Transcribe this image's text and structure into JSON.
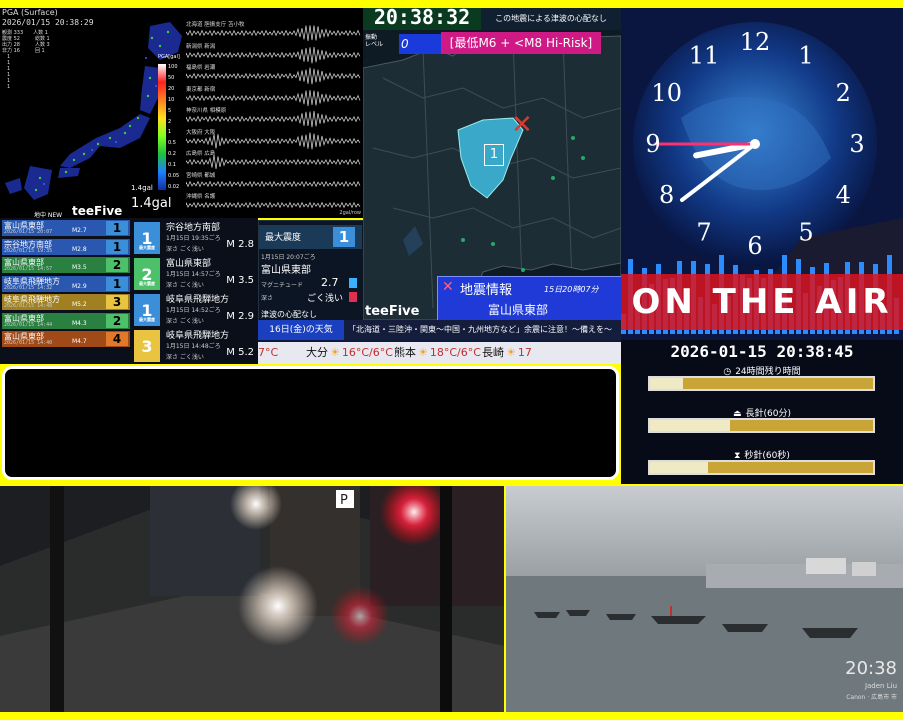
{
  "seismic": {
    "title": "PGA (Surface)",
    "timestamp": "2026/01/15 20:38:29",
    "scale_label": "PGA[gal]",
    "scale_ticks": [
      "100",
      "50",
      "20",
      "10",
      "5",
      "2",
      "1",
      "0.5",
      "0.2",
      "0.1",
      "0.05",
      "0.02"
    ],
    "gal_small": "1.4gal",
    "gal_big": "1.4gal",
    "new_label": "地中 NEW",
    "brand": "teeFive",
    "traces": [
      "北海道 胆振支庁 苫小牧",
      "新潟県 新潟",
      "福島県 岩瀬",
      "東京都 新宿",
      "神奈川県 相模原",
      "大阪府 大阪",
      "広島県 広島",
      "宮崎県 都城",
      "沖縄県 名護"
    ],
    "bottom_right": "2gal/row"
  },
  "history": [
    {
      "region": "富山県東部",
      "date": "2026/01/15 20:07",
      "mag": "M2.7",
      "intensity": "1",
      "color": "#3a8fd8"
    },
    {
      "region": "宗谷地方南部",
      "date": "2026/01/15 19:35",
      "mag": "M2.8",
      "intensity": "1",
      "color": "#3a8fd8"
    },
    {
      "region": "富山県東部",
      "date": "2026/01/15 14:57",
      "mag": "M3.5",
      "intensity": "2",
      "color": "#4cc16a"
    },
    {
      "region": "岐阜県飛騨地方",
      "date": "2026/01/15 14:32",
      "mag": "M2.9",
      "intensity": "1",
      "color": "#3a8fd8"
    },
    {
      "region": "岐阜県飛騨地方",
      "date": "2026/01/15 14:48",
      "mag": "M5.2",
      "intensity": "3",
      "color": "#e8c440"
    },
    {
      "region": "富山県東部",
      "date": "2026/01/15 14:44",
      "mag": "M4.3",
      "intensity": "2",
      "color": "#4cc16a"
    },
    {
      "region": "富山県東部",
      "date": "2026/01/15 14:40",
      "mag": "M4.7",
      "intensity": "4",
      "color": "#e07a2a"
    }
  ],
  "latest": [
    {
      "label": "最大震度",
      "intensity": "1",
      "region": "宗谷地方南部",
      "time": "1月15日 19:35ごろ",
      "depth": "深さ ごく浅い",
      "mag": "M 2.8",
      "color": "#3a8fd8"
    },
    {
      "label": "最大震度",
      "intensity": "2",
      "region": "富山県東部",
      "time": "1月15日 14:57ごろ",
      "depth": "深さ ごく浅い",
      "mag": "M 3.5",
      "color": "#4cc16a"
    },
    {
      "label": "最大震度",
      "intensity": "1",
      "region": "岐阜県飛騨地方",
      "time": "1月15日 14:52ごろ",
      "depth": "深さ ごく浅い",
      "mag": "M 2.9",
      "color": "#3a8fd8"
    },
    {
      "label": "最大震度",
      "intensity": "3",
      "region": "岐阜県飛騨地方",
      "time": "1月15日 14:48ごろ",
      "depth": "深さ ごく浅い",
      "mag": "M 5.2",
      "color": "#e8c440"
    }
  ],
  "info": {
    "max_label": "最大震度",
    "max_value": "1",
    "time": "1月15日 20:07ごろ",
    "region": "富山県東部",
    "mag_label": "マグニチュード",
    "mag_value": "2.7",
    "depth_label": "深さ",
    "depth_value": "ごく浅い",
    "tsunami": "津波の心配なし"
  },
  "map": {
    "clock": "20:38:32",
    "notice": "この地震による津波の心配なし",
    "level_label": "振動\nレベル",
    "level_value": "0",
    "risk": "[最低M6 + <M8 Hi-Risk]",
    "epicenter_intensity": "1",
    "brand": "teeFive",
    "quake_title": "地震情報",
    "quake_time": "15日20時07分",
    "quake_region": "富山県東部"
  },
  "clock": {
    "numbers": [
      "12",
      "1",
      "2",
      "3",
      "4",
      "5",
      "6",
      "7",
      "8",
      "9",
      "10",
      "11"
    ],
    "hours": 20,
    "minutes": 38,
    "seconds": 45,
    "banner": "ON THE AIR",
    "datetime": "2026-01-15 20:38:45"
  },
  "status": {
    "bars": [
      {
        "label": "24時間残り時間",
        "icon": "clock-icon",
        "fill": 0.15
      },
      {
        "label": "長針(60分)",
        "icon": "alarm-icon",
        "fill": 0.36
      },
      {
        "label": "秒針(60秒)",
        "icon": "hourglass-icon",
        "fill": 0.26
      }
    ]
  },
  "weather": {
    "date": "16日(金)の天気",
    "alert": "「北海道・三陸沖・関東～中国・九州地方など」余震に注意！～備えを～",
    "cities": [
      {
        "name": "",
        "temp": "7°C"
      },
      {
        "name": "大分",
        "temp": "16°C/6°C"
      },
      {
        "name": "熊本",
        "temp": "18°C/6°C"
      },
      {
        "name": "長崎",
        "temp": "17"
      }
    ]
  },
  "cam2": {
    "time": "20:38",
    "credit1": "Jaden Liu",
    "credit2": "Canon · 広島市 市"
  },
  "colors": {
    "accent_yellow": "#ffff00",
    "quake_red": "#d93a2e",
    "risk_magenta": "#cf1a86"
  }
}
